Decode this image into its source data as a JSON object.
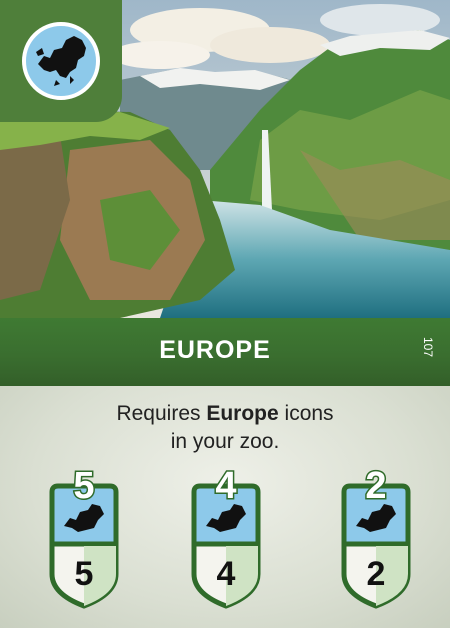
{
  "card": {
    "title": "EUROPE",
    "number": "107",
    "requirement_prefix": "Requires ",
    "requirement_bold": "Europe",
    "requirement_suffix": " icons",
    "requirement_line2": "in your zoo.",
    "region_icon": "europe-continent-icon",
    "colors": {
      "banner": "#3a6e2f",
      "globe": "#8dc9ea",
      "badge_border": "#2f6b2a"
    }
  },
  "tiers": [
    {
      "top": "5",
      "bottom": "5"
    },
    {
      "top": "4",
      "bottom": "4"
    },
    {
      "top": "2",
      "bottom": "2"
    }
  ]
}
